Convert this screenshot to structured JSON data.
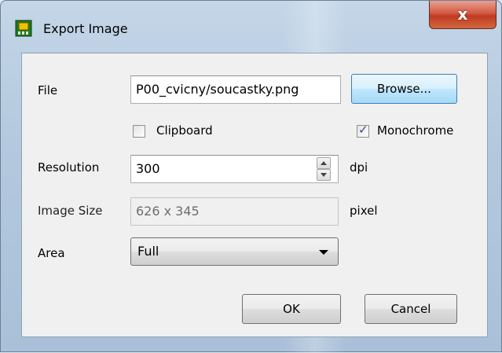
{
  "window": {
    "title": "Export Image",
    "close_symbol": "x"
  },
  "form": {
    "file_label": "File",
    "file_value": "P00_cvicny/soucastky.png",
    "browse_label": "Browse...",
    "clipboard_label": "Clipboard",
    "clipboard_checked": false,
    "monochrome_label": "Monochrome",
    "monochrome_checked": true,
    "resolution_label": "Resolution",
    "resolution_value": "300",
    "resolution_unit": "dpi",
    "image_size_label": "Image Size",
    "image_size_value": "626 x 345",
    "image_size_unit": "pixel",
    "area_label": "Area",
    "area_value": "Full"
  },
  "buttons": {
    "ok_label": "OK",
    "cancel_label": "Cancel"
  },
  "icons": {
    "app": "chip-board-icon",
    "check": "checkmark-icon",
    "spinner_up": "chevron-up-icon",
    "spinner_down": "chevron-down-icon",
    "dropdown": "chevron-down-icon"
  },
  "colors": {
    "close_button": "#c94a30",
    "client_bg": "#f0f0f0",
    "check_mark": "#2f4d8c"
  }
}
